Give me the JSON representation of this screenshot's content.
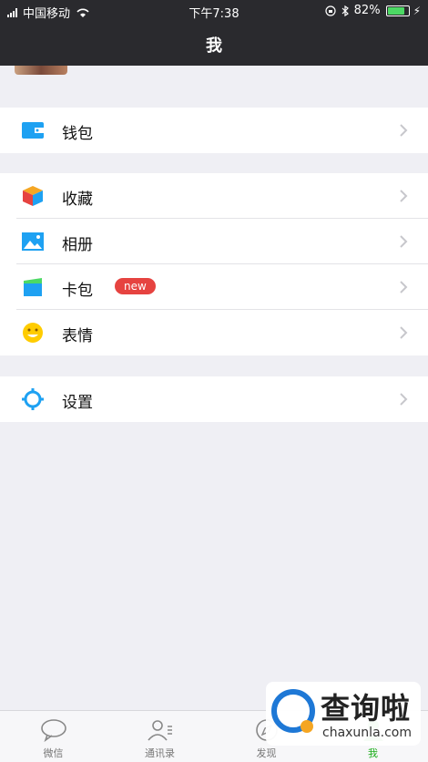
{
  "status_bar": {
    "carrier": "中国移动",
    "time": "下午7:38",
    "battery": "82%",
    "battery_level": 0.82
  },
  "header": {
    "title": "我"
  },
  "wallet_section": {
    "items": [
      {
        "label": "钱包",
        "icon": "wallet-icon"
      }
    ]
  },
  "features_section": {
    "items": [
      {
        "label": "收藏",
        "icon": "cube-icon"
      },
      {
        "label": "相册",
        "icon": "album-icon"
      },
      {
        "label": "卡包",
        "icon": "card-icon",
        "badge": "new"
      },
      {
        "label": "表情",
        "icon": "smiley-icon"
      }
    ]
  },
  "settings_section": {
    "items": [
      {
        "label": "设置",
        "icon": "gear-icon"
      }
    ]
  },
  "tabbar": {
    "tabs": [
      {
        "label": "微信",
        "icon": "chat-bubble-icon"
      },
      {
        "label": "通讯录",
        "icon": "contacts-icon"
      },
      {
        "label": "发现",
        "icon": "compass-icon"
      },
      {
        "label": "我",
        "icon": "person-icon",
        "active": true
      }
    ]
  },
  "watermark": {
    "title": "查询啦",
    "domain": "chaxunla.com"
  },
  "colors": {
    "header_bg": "#2a2a2e",
    "accent_green": "#1aad19",
    "badge_red": "#e64340",
    "page_bg": "#efeff4"
  }
}
